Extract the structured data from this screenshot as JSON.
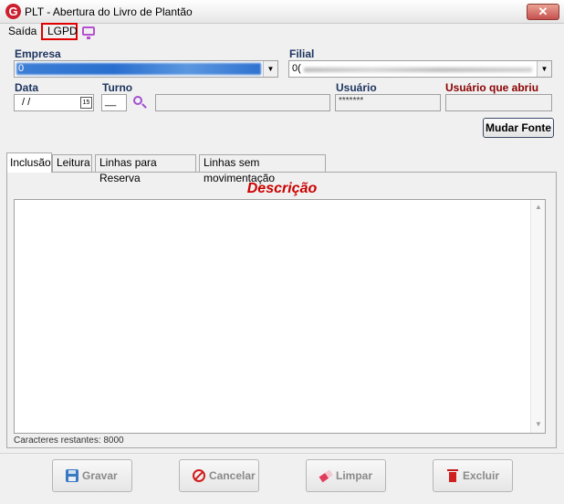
{
  "window": {
    "title": "PLT - Abertura do Livro de Plantão",
    "close": "✕"
  },
  "menu": {
    "saida": "Saída",
    "lgpd": "LGPD"
  },
  "form": {
    "empresa_label": "Empresa",
    "empresa_value": "0",
    "filial_label": "Filial",
    "filial_value": "0(",
    "data_label": "Data",
    "data_value": " / /",
    "calendar_glyph": "15",
    "turno_label": "Turno",
    "turno_value": "__",
    "usuario_label": "Usuário",
    "usuario_value": "*******",
    "usuario_abriu_label": "Usuário que abriu",
    "mudar_fonte": "Mudar Fonte"
  },
  "tabs": [
    {
      "label": "Inclusão",
      "active": true
    },
    {
      "label": "Leitura",
      "active": false
    },
    {
      "label": "Linhas para Reserva",
      "active": false
    },
    {
      "label": "Linhas sem movimentação",
      "active": false
    }
  ],
  "panel": {
    "descricao_title": "Descrição",
    "chars_remaining": "Caracteres restantes: 8000",
    "scroll_up": "▲",
    "scroll_down": "▼"
  },
  "actions": {
    "gravar": "Gravar",
    "cancelar": "Cancelar",
    "limpar": "Limpar",
    "excluir": "Excluir"
  },
  "colors": {
    "accent_red": "#cc0000",
    "label_blue": "#1e3560",
    "label_dark_red": "#8b0000",
    "lgpd_highlight": "#e00000"
  }
}
